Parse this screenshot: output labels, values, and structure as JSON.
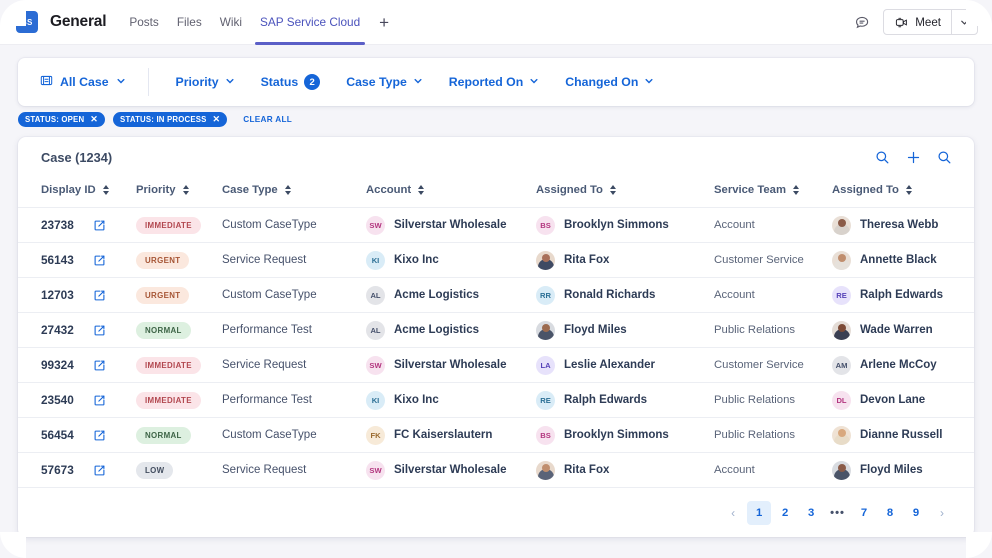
{
  "topbar": {
    "logo_initials": "SS",
    "channel_title": "General",
    "tabs": [
      {
        "label": "Posts",
        "active": false
      },
      {
        "label": "Files",
        "active": false
      },
      {
        "label": "Wiki",
        "active": false
      },
      {
        "label": "SAP Service Cloud",
        "active": true
      }
    ],
    "add_tab_label": "+",
    "meet_label": "Meet",
    "accent": "#5b5fc7"
  },
  "filterbar": {
    "all_case_label": "All Case",
    "filters": [
      {
        "label": "Priority",
        "caret": true,
        "count": null
      },
      {
        "label": "Status",
        "caret": false,
        "count": "2"
      },
      {
        "label": "Case Type",
        "caret": true,
        "count": null
      },
      {
        "label": "Reported On",
        "caret": true,
        "count": null
      },
      {
        "label": "Changed On",
        "caret": true,
        "count": null
      }
    ],
    "accent": "#1565d8"
  },
  "chips": {
    "items": [
      "STATUS: OPEN",
      "STATUS: IN PROCESS"
    ],
    "clear_all_label": "CLEAR ALL"
  },
  "card": {
    "title": "Case (1234)",
    "actions": [
      "search-icon",
      "plus-icon",
      "search-advanced-icon"
    ],
    "columns": [
      {
        "label": "Display ID",
        "sortable": true
      },
      {
        "label": "Priority",
        "sortable": true
      },
      {
        "label": "Case Type",
        "sortable": true
      },
      {
        "label": "Account",
        "sortable": true
      },
      {
        "label": "Assigned To",
        "sortable": true
      },
      {
        "label": "Service Team",
        "sortable": true
      },
      {
        "label": "Assigned To",
        "sortable": true
      }
    ],
    "rows": [
      {
        "display_id": "23738",
        "priority": "IMMEDIATE",
        "priority_key": "immediate",
        "case_type": "Custom CaseType",
        "account": "Silverstar Wholesale",
        "account_initials": "SW",
        "account_bg": "#f7e2ef",
        "account_fg": "#b2347e",
        "assigned_to": "Brooklyn Simmons",
        "assigned_initials": "BS",
        "assigned_bg": "#f7e2ef",
        "assigned_fg": "#b2347e",
        "assigned_photo": false,
        "service_team": "Account",
        "assigned_to_2": "Theresa Webb",
        "assigned2_initials": "TW",
        "assigned2_bg": "#e9dfd6",
        "assigned2_fg": "#6a4a3a",
        "assigned2_photo": true,
        "photo2_skin": "#8a5b48",
        "photo2_cloth": "#d8d2cc"
      },
      {
        "display_id": "56143",
        "priority": "URGENT",
        "priority_key": "urgent",
        "case_type": "Service Request",
        "account": "Kixo Inc",
        "account_initials": "KI",
        "account_bg": "#d9ecf7",
        "account_fg": "#2b6f95",
        "assigned_to": "Rita Fox",
        "assigned_initials": "RF",
        "assigned_bg": "#e8d9cc",
        "assigned_fg": "#6a4a3a",
        "assigned_photo": true,
        "photo_skin": "#a9705a",
        "photo_cloth": "#3f4a63",
        "service_team": "Customer Service",
        "assigned_to_2": "Annette Black",
        "assigned2_initials": "AB",
        "assigned2_bg": "#e9dfd6",
        "assigned2_fg": "#6a4a3a",
        "assigned2_photo": true,
        "photo2_skin": "#c08e6e",
        "photo2_cloth": "#e6e1db"
      },
      {
        "display_id": "12703",
        "priority": "URGENT",
        "priority_key": "urgent",
        "case_type": "Custom CaseType",
        "account": "Acme Logistics",
        "account_initials": "AL",
        "account_bg": "#e3e4e8",
        "account_fg": "#45506b",
        "assigned_to": "Ronald Richards",
        "assigned_initials": "RR",
        "assigned_bg": "#d9ecf7",
        "assigned_fg": "#2b6f95",
        "assigned_photo": false,
        "service_team": "Account",
        "assigned_to_2": "Ralph Edwards",
        "assigned2_initials": "RE",
        "assigned2_bg": "#e7e2fb",
        "assigned2_fg": "#5642b8",
        "assigned2_photo": false
      },
      {
        "display_id": "27432",
        "priority": "NORMAL",
        "priority_key": "normal",
        "case_type": "Performance Test",
        "account": "Acme Logistics",
        "account_initials": "AL",
        "account_bg": "#e3e4e8",
        "account_fg": "#45506b",
        "assigned_to": "Floyd Miles",
        "assigned_initials": "FM",
        "assigned_bg": "#d8dbe0",
        "assigned_fg": "#45506b",
        "assigned_photo": true,
        "photo_skin": "#9c6b4f",
        "photo_cloth": "#4a5468",
        "service_team": "Public Relations",
        "assigned_to_2": "Wade Warren",
        "assigned2_initials": "WW",
        "assigned2_bg": "#e4dcd6",
        "assigned2_fg": "#6a4a3a",
        "assigned2_photo": true,
        "photo2_skin": "#7c4a36",
        "photo2_cloth": "#3a3f52"
      },
      {
        "display_id": "99324",
        "priority": "IMMEDIATE",
        "priority_key": "immediate",
        "case_type": "Service Request",
        "account": "Silverstar Wholesale",
        "account_initials": "SW",
        "account_bg": "#f7e2ef",
        "account_fg": "#b2347e",
        "assigned_to": "Leslie Alexander",
        "assigned_initials": "LA",
        "assigned_bg": "#e7e2fb",
        "assigned_fg": "#5642b8",
        "assigned_photo": false,
        "service_team": "Customer Service",
        "assigned_to_2": "Arlene McCoy",
        "assigned2_initials": "AM",
        "assigned2_bg": "#e3e4e8",
        "assigned2_fg": "#45506b",
        "assigned2_photo": false
      },
      {
        "display_id": "23540",
        "priority": "IMMEDIATE",
        "priority_key": "immediate",
        "case_type": "Performance Test",
        "account": "Kixo Inc",
        "account_initials": "KI",
        "account_bg": "#d9ecf7",
        "account_fg": "#2b6f95",
        "assigned_to": "Ralph Edwards",
        "assigned_initials": "RE",
        "assigned_bg": "#d9ecf7",
        "assigned_fg": "#2b6f95",
        "assigned_photo": false,
        "service_team": "Public Relations",
        "assigned_to_2": "Devon Lane",
        "assigned2_initials": "DL",
        "assigned2_bg": "#f7e2ef",
        "assigned2_fg": "#b2347e",
        "assigned2_photo": false
      },
      {
        "display_id": "56454",
        "priority": "NORMAL",
        "priority_key": "normal",
        "case_type": "Custom CaseType",
        "account": "FC Kaiserslautern",
        "account_initials": "FK",
        "account_bg": "#f7ead8",
        "account_fg": "#9a6a2e",
        "assigned_to": "Brooklyn Simmons",
        "assigned_initials": "BS",
        "assigned_bg": "#f7e2ef",
        "assigned_fg": "#b2347e",
        "assigned_photo": false,
        "service_team": "Public Relations",
        "assigned_to_2": "Dianne Russell",
        "assigned2_initials": "DR",
        "assigned2_bg": "#efe2d4",
        "assigned2_fg": "#6a4a3a",
        "assigned2_photo": true,
        "photo2_skin": "#d8a87e",
        "photo2_cloth": "#e8dcc8"
      },
      {
        "display_id": "57673",
        "priority": "LOW",
        "priority_key": "low",
        "case_type": "Service Request",
        "account": "Silverstar Wholesale",
        "account_initials": "SW",
        "account_bg": "#f7e2ef",
        "account_fg": "#b2347e",
        "assigned_to": "Rita Fox",
        "assigned_initials": "RF",
        "assigned_bg": "#e8d9cc",
        "assigned_fg": "#6a4a3a",
        "assigned_photo": true,
        "photo_skin": "#c08e6e",
        "photo_cloth": "#5a6378",
        "service_team": "Account",
        "assigned_to_2": "Floyd Miles",
        "assigned2_initials": "FM",
        "assigned2_bg": "#d8dbe0",
        "assigned2_fg": "#45506b",
        "assigned2_photo": true,
        "photo2_skin": "#8a5b48",
        "photo2_cloth": "#4a5468"
      }
    ]
  },
  "pagination": {
    "prev_label": "‹",
    "next_label": "›",
    "pages": [
      "1",
      "2",
      "3",
      "•••",
      "7",
      "8",
      "9"
    ],
    "active_page": "1",
    "dots_index": 3
  }
}
